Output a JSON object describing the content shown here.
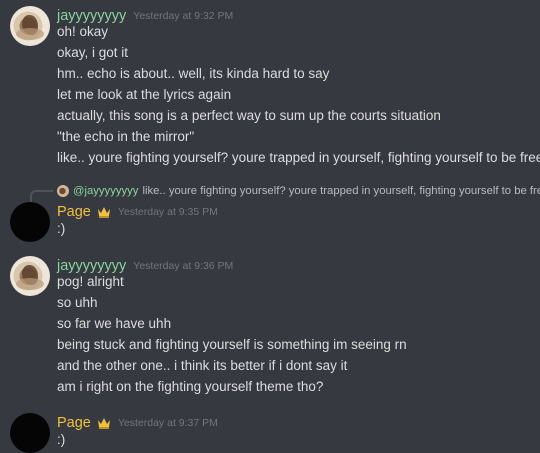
{
  "messages": [
    {
      "user": "jayyyyyyyy",
      "time": "Yesterday at 9:32 PM",
      "lines": [
        "oh! okay",
        "okay, i got it",
        "hm.. echo is about.. well, its kinda hard to say",
        "let me look at the lyrics again",
        "actually, this song is a perfect way to sum up the courts situation",
        "\"the echo in the mirror\"",
        "like.. youre fighting yourself? youre trapped in yourself, fighting yourself to be free"
      ]
    },
    {
      "reply": {
        "user": "@jayyyyyyyy",
        "text": "like.. youre fighting yourself? youre trapped in yourself, fighting yourself to be free"
      },
      "user": "Page",
      "time": "Yesterday at 9:35 PM",
      "lines": [
        ":)"
      ]
    },
    {
      "user": "jayyyyyyyy",
      "time": "Yesterday at 9:36 PM",
      "lines": [
        "pog! alright",
        "so uhh",
        "so far we have uhh",
        "being stuck and fighting yourself is something im seeing rn",
        "and the other one.. i think its better if i dont say it",
        "am i right on the fighting yourself theme tho?"
      ]
    },
    {
      "user": "Page",
      "time": "Yesterday at 9:37 PM",
      "lines": [
        ":)"
      ]
    }
  ],
  "colors": {
    "background": "#36393f",
    "jay_name": "#8bd3a0",
    "page_name": "#f0c040",
    "text": "#dcddde",
    "timestamp": "#72767d"
  },
  "icons": {
    "role": "crown-icon",
    "reply": "reply-spine-icon"
  }
}
